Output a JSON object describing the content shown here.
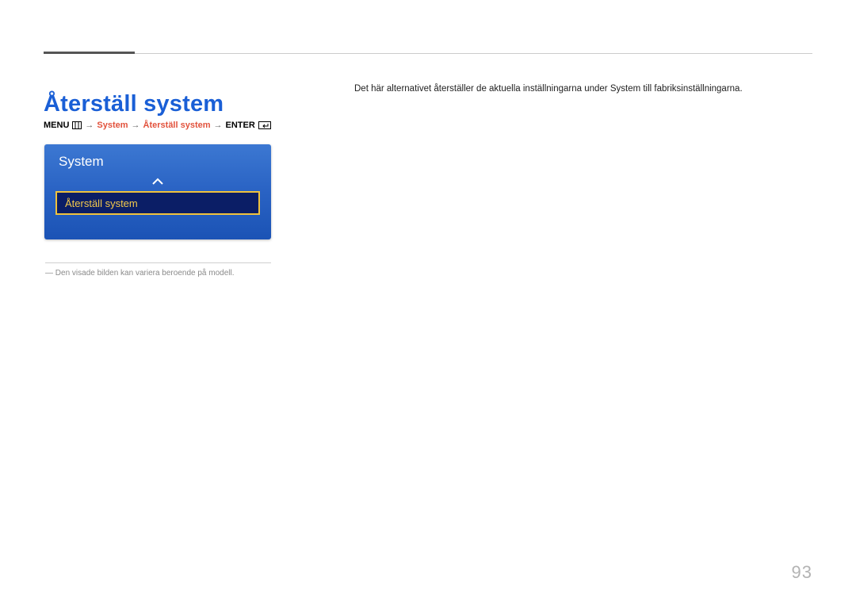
{
  "page": {
    "title": "Återställ system",
    "body": "Det här alternativet återställer de aktuella inställningarna under System till fabriksinställningarna.",
    "page_number": "93"
  },
  "breadcrumb": {
    "menu_label": "MENU",
    "l1": "System",
    "l2": "Återställ system",
    "enter_label": "ENTER"
  },
  "panel": {
    "title": "System",
    "selected_item": "Återställ system"
  },
  "footnote": {
    "dash": "― ",
    "text": "Den visade bilden kan variera beroende på modell."
  }
}
